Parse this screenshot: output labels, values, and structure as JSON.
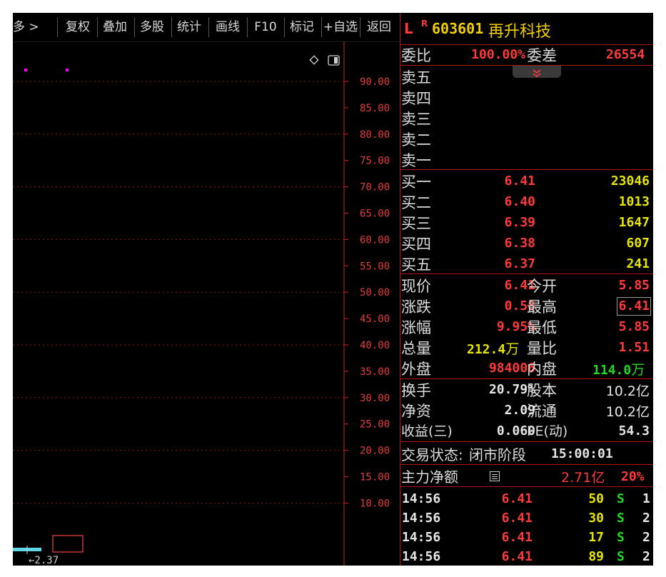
{
  "toolbar": {
    "items": [
      "多 >",
      "复权",
      "叠加",
      "多股",
      "统计",
      "画线",
      "F10",
      "标记",
      "+自选",
      "返回"
    ]
  },
  "chart": {
    "price_labels": [
      "90.00",
      "85.00",
      "80.00",
      "75.00",
      "70.00",
      "65.00",
      "60.00",
      "55.00",
      "50.00",
      "45.00",
      "40.00",
      "35.00",
      "30.00",
      "25.00",
      "20.00",
      "15.00",
      "10.00"
    ],
    "low_label": "←2.37",
    "marker_glyph": "S",
    "colors": {
      "axis": "#d42020",
      "grid": "#8a1a1a",
      "label": "#e23c3c",
      "low_bar": "#5fd7e6",
      "marker": "#ff00ff"
    }
  },
  "header": {
    "prefix": "L",
    "badge": "R",
    "code": "603601",
    "name": "再升科技"
  },
  "ratio": {
    "label_ratio": "委比",
    "ratio": "100.00%",
    "label_diff": "委差",
    "diff": "26554"
  },
  "sell_levels": [
    {
      "label": "卖五"
    },
    {
      "label": "卖四"
    },
    {
      "label": "卖三"
    },
    {
      "label": "卖二"
    },
    {
      "label": "卖一"
    }
  ],
  "buy_levels": [
    {
      "label": "买一",
      "price": "6.41",
      "volume": "23046"
    },
    {
      "label": "买二",
      "price": "6.40",
      "volume": "1013"
    },
    {
      "label": "买三",
      "price": "6.39",
      "volume": "1647"
    },
    {
      "label": "买四",
      "price": "6.38",
      "volume": "607"
    },
    {
      "label": "买五",
      "price": "6.37",
      "volume": "241"
    }
  ],
  "quote": {
    "now_label": "现价",
    "now": "6.41",
    "open_label": "今开",
    "open": "5.85",
    "change_label": "涨跌",
    "change": "0.58",
    "high_label": "最高",
    "high": "6.41",
    "pct_label": "涨幅",
    "pct": "9.95%",
    "low_label": "最低",
    "low": "5.85",
    "vol_label": "总量",
    "vol": "212.4",
    "vol_unit": "万",
    "vr_label": "量比",
    "vr": "1.51",
    "out_label": "外盘",
    "out": "984006",
    "in_label": "内盘",
    "in": "114.0",
    "in_unit": "万"
  },
  "fund": {
    "turnover_label": "换手",
    "turnover": "20.79%",
    "shares_label": "股本",
    "shares": "10.2亿",
    "nav_label": "净资",
    "nav": "2.09",
    "float_label": "流通",
    "float": "10.2亿",
    "eps_label": "收益(三)",
    "eps": "0.060",
    "pe_label": "PE(动)",
    "pe": "54.3"
  },
  "status": {
    "label": "交易状态:",
    "value": "闭市阶段",
    "time": "15:00:01"
  },
  "main_flow": {
    "label": "主力净额",
    "amount": "2.71亿",
    "pct": "20%"
  },
  "ticks": [
    {
      "time": "14:56",
      "price": "6.41",
      "vol": "50",
      "side": "S",
      "n": "1"
    },
    {
      "time": "14:56",
      "price": "6.41",
      "vol": "30",
      "side": "S",
      "n": "2"
    },
    {
      "time": "14:56",
      "price": "6.41",
      "vol": "17",
      "side": "S",
      "n": "2"
    },
    {
      "time": "14:56",
      "price": "6.41",
      "vol": "89",
      "side": "S",
      "n": "2"
    }
  ]
}
